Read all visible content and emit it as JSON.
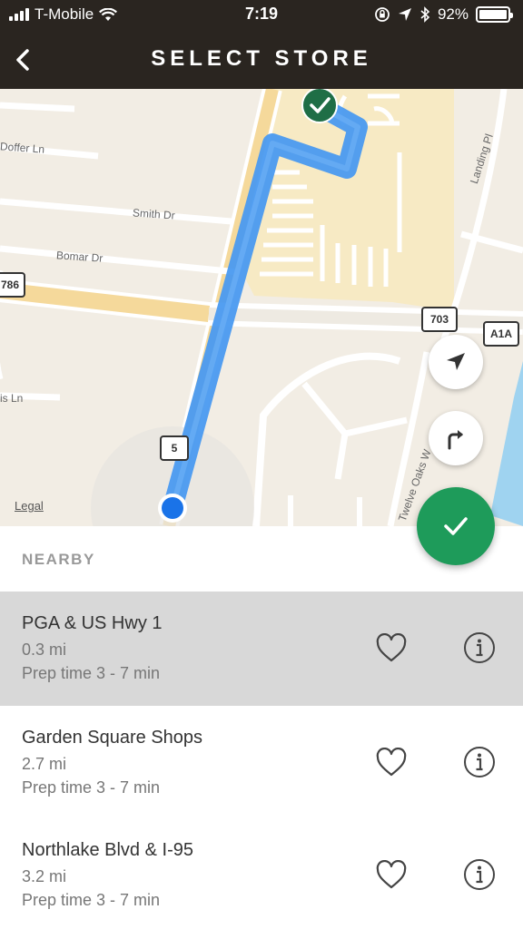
{
  "status_bar": {
    "carrier": "T-Mobile",
    "time": "7:19",
    "battery": "92%"
  },
  "nav": {
    "title": "SELECT STORE"
  },
  "map": {
    "streets": [
      "Doffer Ln",
      "Smith Dr",
      "Bomar Dr",
      "Landing Pl",
      "is Ln",
      "Twelve Oaks W"
    ],
    "route_badges": [
      "786",
      "703",
      "A1A",
      "5"
    ],
    "legal_label": "Legal",
    "route_color": "#4a9af0",
    "destination_color": "#1f6e46",
    "current_location_color": "#1a73e8"
  },
  "actions": {
    "accent_color": "#1e9b5a"
  },
  "nearby": {
    "label": "NEARBY",
    "stores": [
      {
        "name": "PGA & US Hwy 1",
        "distance": "0.3 mi",
        "prep": "Prep time 3 - 7 min",
        "selected": true
      },
      {
        "name": "Garden Square Shops",
        "distance": "2.7 mi",
        "prep": "Prep time 3 - 7 min",
        "selected": false
      },
      {
        "name": "Northlake Blvd & I-95",
        "distance": "3.2 mi",
        "prep": "Prep time 3 - 7 min",
        "selected": false
      }
    ]
  }
}
